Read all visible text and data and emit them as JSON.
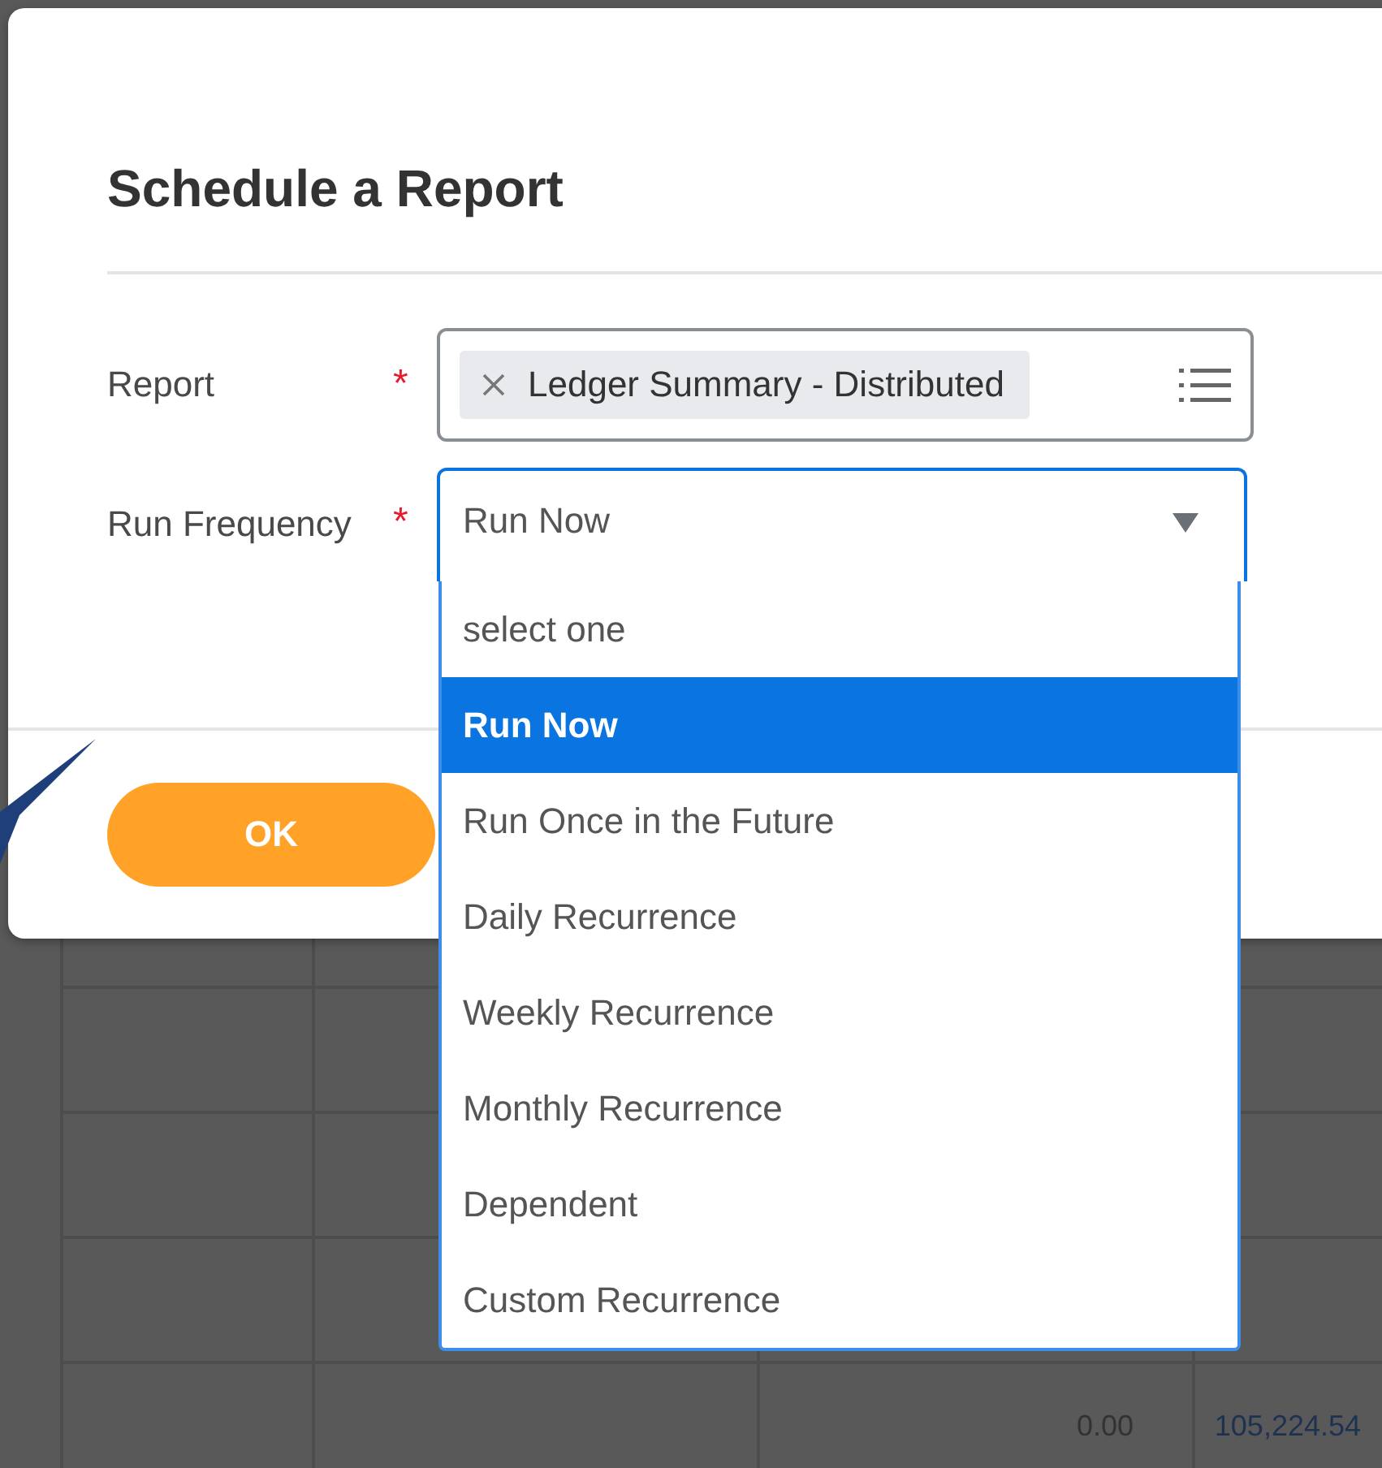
{
  "dialog": {
    "title": "Schedule a Report",
    "fields": [
      {
        "kind": "multiselect",
        "label": "Report",
        "required_mark": "*",
        "chips": [
          "Ledger Summary - Distributed"
        ]
      },
      {
        "kind": "dropdown",
        "label": "Run Frequency",
        "required_mark": "*",
        "value": "Run Now",
        "expanded": true,
        "options": [
          {
            "label": "select one",
            "selected": false
          },
          {
            "label": "Run Now",
            "selected": true
          },
          {
            "label": "Run Once in the Future",
            "selected": false
          },
          {
            "label": "Daily Recurrence",
            "selected": false
          },
          {
            "label": "Weekly Recurrence",
            "selected": false
          },
          {
            "label": "Monthly Recurrence",
            "selected": false
          },
          {
            "label": "Dependent",
            "selected": false
          },
          {
            "label": "Custom Recurrence",
            "selected": false
          }
        ]
      }
    ],
    "buttons": [
      "OK"
    ]
  },
  "table": {
    "rows": [
      {
        "column_3": "0.00",
        "column_4": "105,224.54"
      }
    ]
  }
}
